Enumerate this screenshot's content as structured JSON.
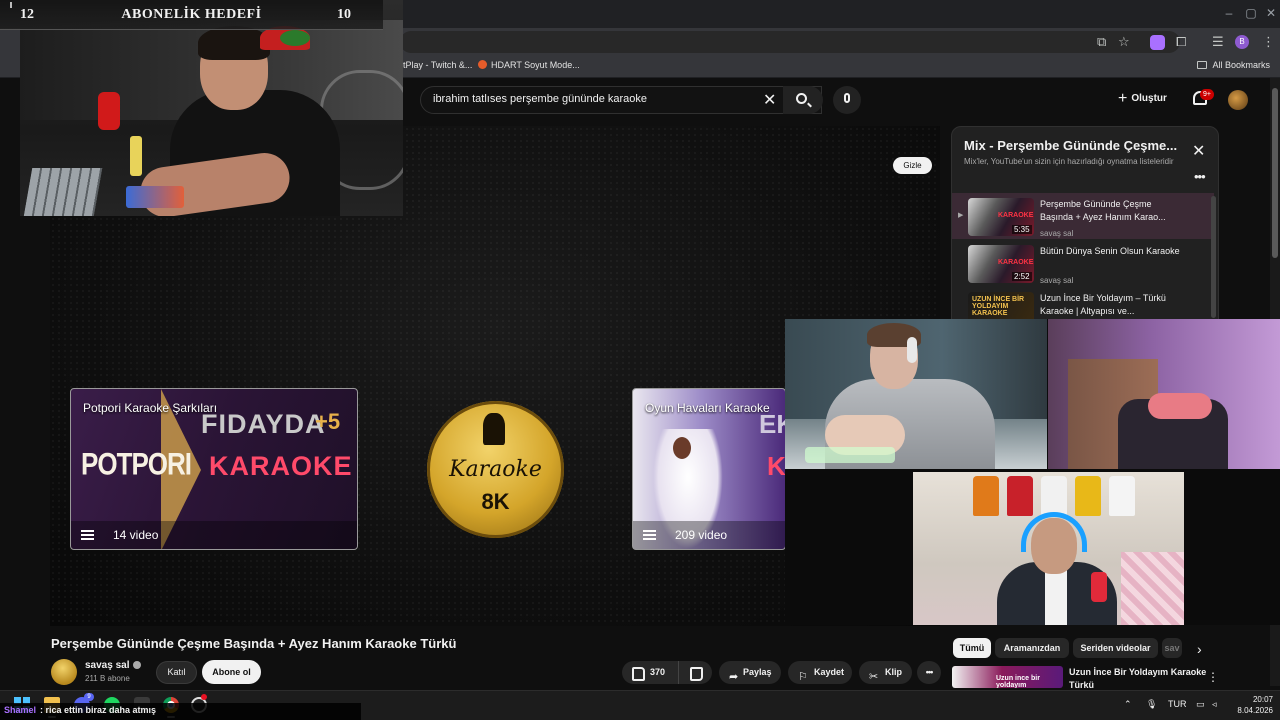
{
  "browser": {
    "bookmarks": [
      {
        "label": "tPlay - Twitch &..."
      },
      {
        "label": "HDART Soyut Mode..."
      }
    ],
    "all_bookmarks": "All Bookmarks",
    "profile_initial": "B"
  },
  "masthead": {
    "search_query": "ibrahim tatlıses perşembe gününde karaoke",
    "create_label": "Oluştur",
    "notifications_badge": "9+"
  },
  "player": {
    "hide_label": "Gizle",
    "end_cards": [
      {
        "label": "Potpori Karaoke Şarkıları",
        "count": "14 video",
        "art_words": [
          "POTPORI",
          "FIDAYDA",
          "+5",
          "KARAOKE"
        ]
      },
      {
        "label": "Oyun Havaları Karaoke",
        "count": "209 video",
        "art_words": [
          "EK",
          "K"
        ]
      }
    ],
    "channel_logo": {
      "word": "Karaoke",
      "tag": "8K"
    }
  },
  "sub_goal": {
    "current": "12",
    "title": "ABONELİK HEDEFİ",
    "target": "10"
  },
  "playlist": {
    "title": "Mix - Perşembe Gününde Çeşme...",
    "subtitle": "Mix'ler, YouTube'un sizin için hazırladığı oynatma listeleridir",
    "items": [
      {
        "title": "Perşembe Gününde Çeşme Başında + Ayez Hanım Karao...",
        "channel": "savaş sal",
        "duration": "5:35",
        "thumb_text": "KARAOKE",
        "active": true
      },
      {
        "title": "Bütün Dünya Senin Olsun Karaoke",
        "channel": "savaş sal",
        "duration": "2:52",
        "thumb_text": "KARAOKE",
        "active": false
      },
      {
        "title": "Uzun İnce Bir Yoldayım – Türkü Karaoke | Altyapısı ve...",
        "channel": "",
        "duration": "",
        "thumb_text": "UZUN İNCE BİR YOLDAYIM KARAOKE",
        "active": false
      }
    ]
  },
  "video": {
    "title": "Perşembe Gününde Çeşme Başında + Ayez Hanım Karaoke Türkü",
    "channel_name": "savaş sal",
    "subscribers": "211 B abone",
    "join_label": "Katıl",
    "subscribe_label": "Abone ol",
    "likes": "370",
    "share_label": "Paylaş",
    "save_label": "Kaydet",
    "clip_label": "Klip"
  },
  "chips": [
    {
      "label": "Tümü"
    },
    {
      "label": "Aramanızdan"
    },
    {
      "label": "Seriden videolar"
    },
    {
      "label": "sav"
    }
  ],
  "recommendation": {
    "title": "Uzun İnce Bir Yoldayım Karaoke Türkü",
    "thumb_text": "Uzun ince bir yoldayım"
  },
  "taskbar": {
    "discord_badge": "9",
    "chat_user": "Shamel",
    "chat_message": ": rica ettin biraz daha atmış",
    "language": "TUR",
    "time": "20:07",
    "date": "8.04.2026"
  },
  "colors": {
    "background": "#0f0f0f",
    "accent_red": "#cc0000",
    "twitch_purple": "#a970ff",
    "karaoke_gold": "#d4a52a"
  }
}
